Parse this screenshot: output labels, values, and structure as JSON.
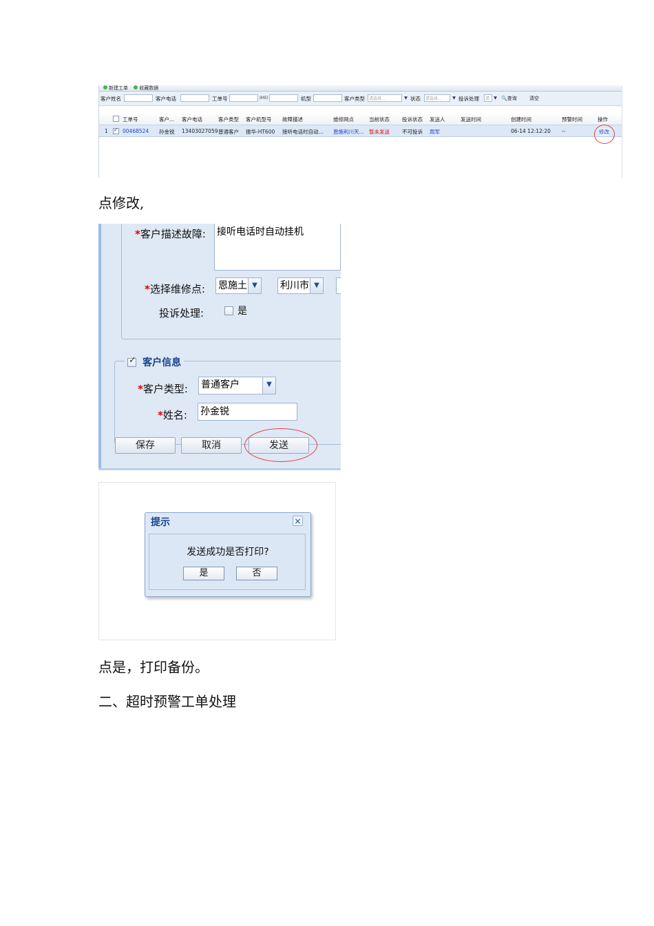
{
  "shot1": {
    "toolbar": [
      "新建工单",
      "收藏数据"
    ],
    "filters": {
      "customer_name": "客户姓名",
      "customer_phone": "客户电话",
      "order_no": "工单号",
      "imei": "IMEI",
      "model": "机型",
      "customer_type": "客户类型",
      "customer_type_value": "请选择...",
      "status": "状态",
      "status_value": "请选择...",
      "complaint": "投诉处理",
      "complaint_value": "请",
      "search": "查询",
      "clear": "清空"
    },
    "columns": [
      "工单号",
      "客户...",
      "客户电话",
      "客户类型",
      "客户机型号",
      "故障描述",
      "维修网点",
      "当前状态",
      "投诉状态",
      "发送人",
      "发送时间",
      "创建时间",
      "预警时间",
      "操作"
    ],
    "row": {
      "index": "1",
      "order_no": "00468524",
      "customer": "孙金锐",
      "phone": "13403027059",
      "type": "普通客户",
      "model": "振华-HT600",
      "fault": "接听电话时自动...",
      "site": "恩施利川天...",
      "status": "暂未发送",
      "complaint_status": "不可投诉",
      "sender": "周军",
      "send_time": "",
      "create_time": "06-14 12:12:20",
      "warn_time": "--",
      "action": "修改"
    }
  },
  "caption1": "点修改,",
  "shot2": {
    "fault_label": "客户描述故障:",
    "fault_value": "接听电话时自动挂机",
    "site_label": "选择维修点:",
    "site_city": "恩施土",
    "site_county": "利川市",
    "complaint_label": "投诉处理:",
    "complaint_yes": "是",
    "section_title": "客户信息",
    "type_label": "客户类型:",
    "type_value": "普通客户",
    "name_label": "姓名:",
    "name_value": "孙金锐",
    "required_mark": "*",
    "btn_save": "保存",
    "btn_cancel": "取消",
    "btn_send": "发送"
  },
  "shot3": {
    "title": "提示",
    "message": "发送成功是否打印?",
    "btn_yes": "是",
    "btn_no": "否",
    "close": "×"
  },
  "caption2": "点是，打印备份。",
  "heading": "二、超时预警工单处理",
  "colors": {
    "link_blue": "#1e3fd0",
    "status_red": "#e01010",
    "highlight_circle": "#e04040",
    "title_blue": "#15428b"
  }
}
